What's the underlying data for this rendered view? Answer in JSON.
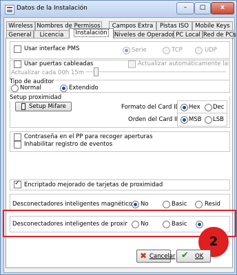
{
  "window": {
    "title": "Datos de la Instalación",
    "controls": {
      "minimize": "–",
      "maximize": "□",
      "close": "x"
    }
  },
  "tabs_row1": [
    "Wireless",
    "Nombres de Permisos",
    "Campos Extra",
    "Pistas ISO",
    "Mobile Keys"
  ],
  "tabs_row2": [
    "General",
    "Licencia",
    "Instalación",
    "Niveles de Operadores",
    "PC Local",
    "Red de PCs"
  ],
  "active_tab": "Instalación",
  "pms": {
    "checkbox_label": "Usar interface PMS",
    "checked": false,
    "options": [
      "Serie",
      "TCP",
      "UDP"
    ],
    "selected": "Serie"
  },
  "wired_doors": {
    "checkbox_label": "Usar puertas cableadas",
    "checked": false,
    "auto_update_label": "Actualizar automáticamente las puertas",
    "update_every_label": "Actualizar cada 00h 15m"
  },
  "auditor": {
    "title": "Tipo de auditor",
    "options": [
      "Normal",
      "Extendido"
    ],
    "selected": "Extendido"
  },
  "proximity": {
    "title": "Setup proximidad",
    "setup_button": "Setup Mifare",
    "card_id_format_label": "Formato del Card ID :",
    "format_options": [
      "Hex",
      "Dec"
    ],
    "format_selected": "Hex",
    "card_id_order_label": "Orden del Card ID :",
    "order_options": [
      "MSB",
      "LSB"
    ],
    "order_selected": "MSB"
  },
  "options": {
    "pp_password_label": "Contraseña en el PP para recoger aperturas",
    "pp_password_checked": false,
    "disable_log_label": "Inhabilitar registro de eventos",
    "disable_log_checked": false,
    "encrypted_label": "Encriptado mejorado de tarjetas de proximidad",
    "encrypted_checked": true
  },
  "magnetic": {
    "label": "Desconectadores inteligentes magnéticos",
    "options": [
      "No",
      "Basic",
      "Resid"
    ],
    "selected": "No"
  },
  "proximity_disconnectors": {
    "label": "Desconectadores inteligentes de proximidad",
    "options": [
      "No",
      "Basic"
    ],
    "selected": "third"
  },
  "annotation": {
    "badge": "2",
    "color": "#e02020"
  },
  "footer": {
    "cancel": "Cancelar",
    "ok": "OK"
  }
}
